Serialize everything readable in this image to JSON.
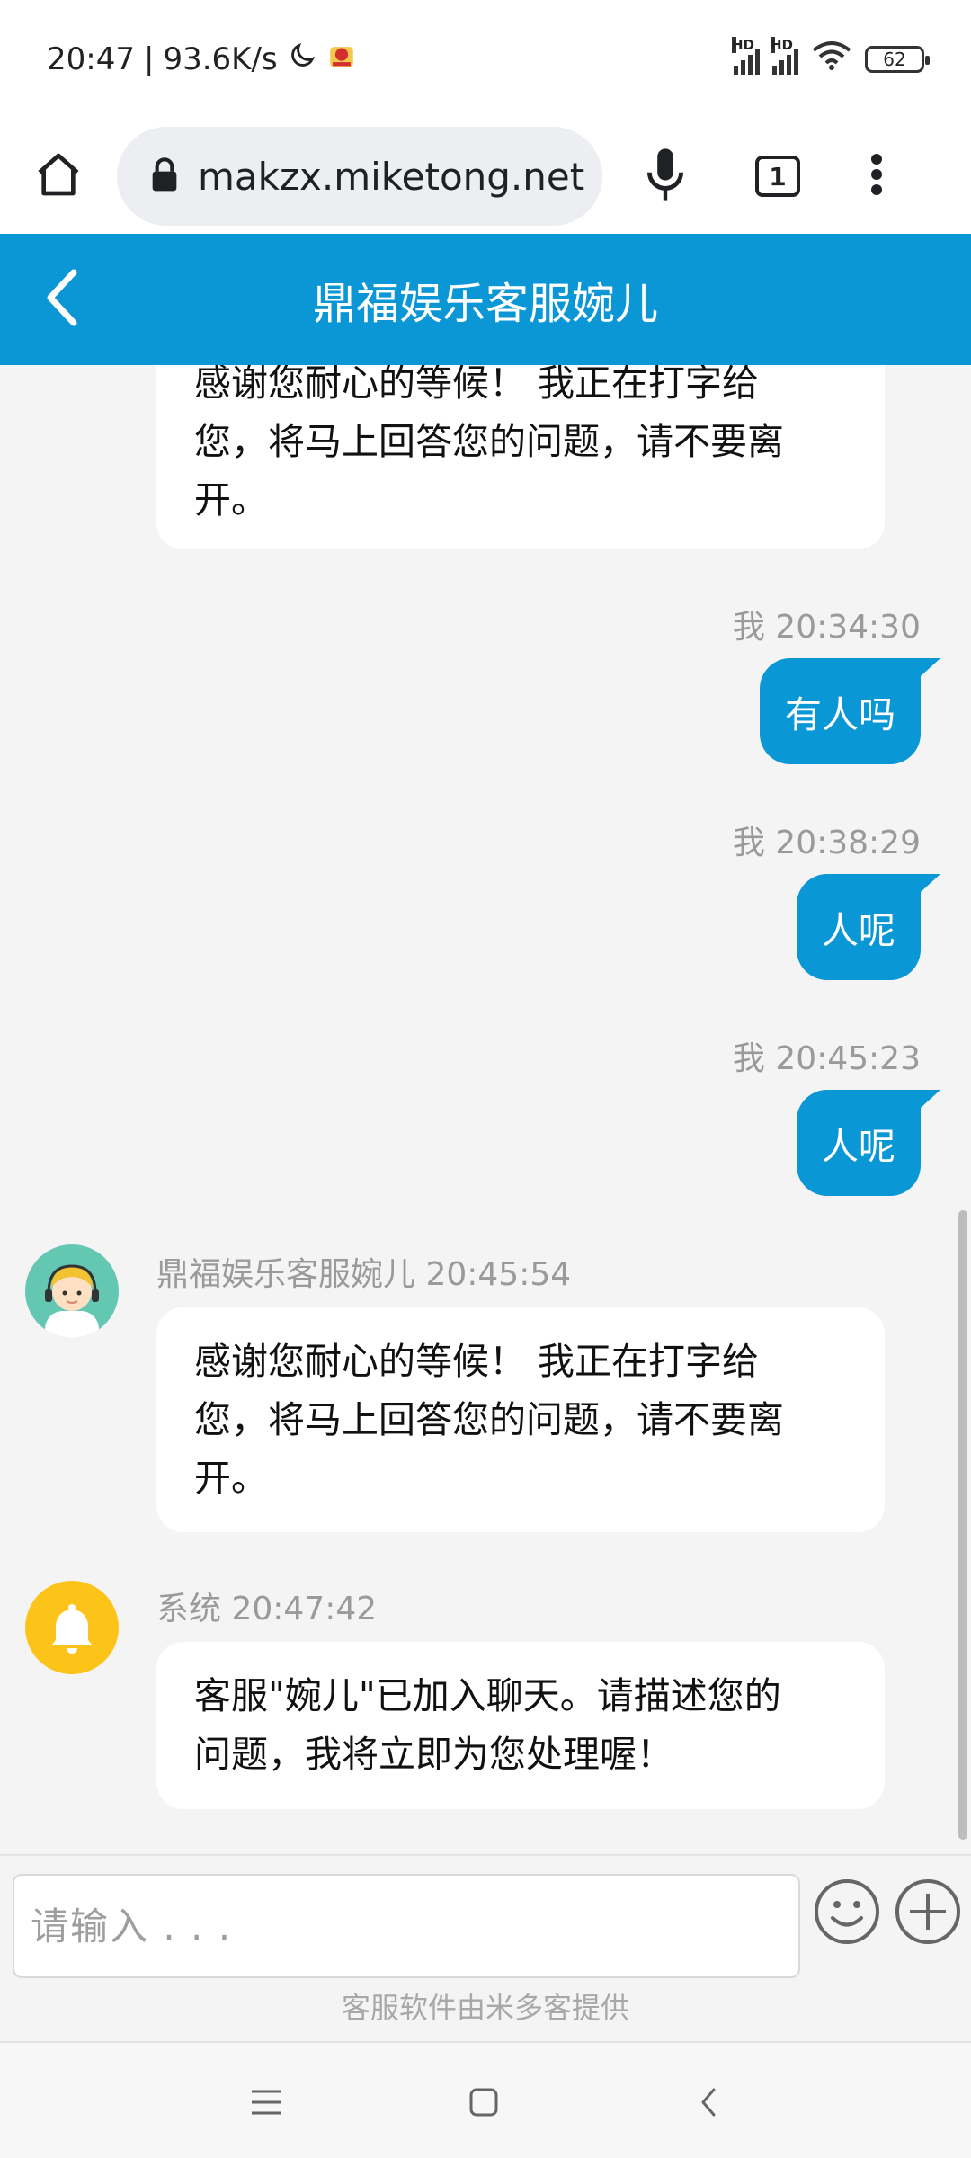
{
  "status_bar": {
    "time": "20:47",
    "net_speed": "93.6K/s",
    "battery": "62",
    "hd1": "HD",
    "hd2": "HD"
  },
  "browser": {
    "url": "makzx.miketong.net",
    "tab_count": "1"
  },
  "chat": {
    "title": "鼎福娱乐客服婉儿"
  },
  "messages": {
    "m1": {
      "text_line1": "感谢您耐心的等候！ 我正在打字给",
      "text_line2": "您，将马上回答您的问题，请不要离",
      "text_line3": "开。"
    },
    "m2": {
      "meta": "我 20:34:30",
      "text": "有人吗"
    },
    "m3": {
      "meta": "我 20:38:29",
      "text": "人呢"
    },
    "m4": {
      "meta": "我 20:45:23",
      "text": "人呢"
    },
    "m5": {
      "meta": "鼎福娱乐客服婉儿 20:45:54",
      "text_line1": "感谢您耐心的等候！ 我正在打字给",
      "text_line2": "您，将马上回答您的问题，请不要离",
      "text_line3": "开。"
    },
    "m6": {
      "meta": "系统 20:47:42",
      "text_line1": "客服\"婉儿\"已加入聊天。请描述您的",
      "text_line2": "问题，我将立即为您处理喔！"
    }
  },
  "input": {
    "placeholder": "请输入 . . ."
  },
  "footer": {
    "text": "客服软件由米多客提供"
  },
  "icons": {
    "home": "home-icon",
    "lock": "lock-icon",
    "mic": "mic-icon",
    "tabs": "tabs-icon",
    "more": "more-vertical-icon",
    "back": "chevron-left-icon",
    "agent_avatar": "agent-headset-avatar",
    "system_avatar": "bell-icon",
    "emoji": "emoji-icon",
    "plus": "plus-circle-icon"
  },
  "colors": {
    "header": "#0b97d6",
    "user_bubble": "#0a97d6",
    "system_avatar": "#fcc419",
    "agent_avatar": "#63c7b2"
  }
}
